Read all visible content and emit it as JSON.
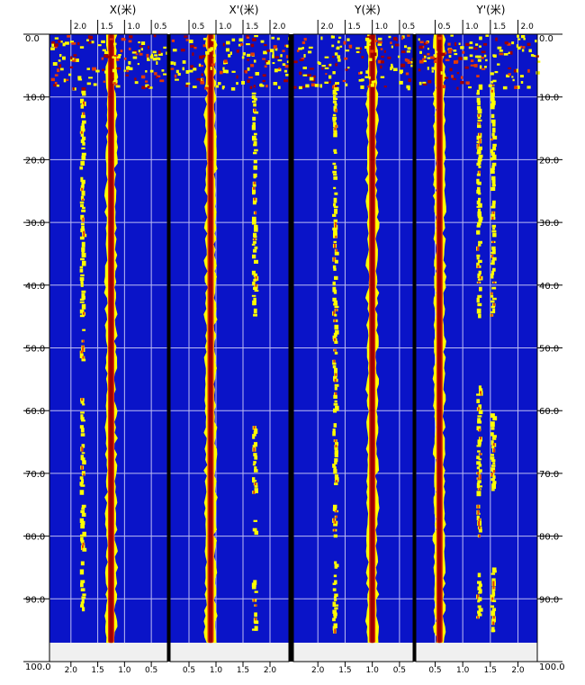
{
  "chart_data": {
    "type": "heatmap",
    "title": "",
    "depth_axis": {
      "range": [
        0,
        100
      ],
      "tick_labels": [
        "0.0",
        "10.0",
        "20.0",
        "30.0",
        "40.0",
        "50.0",
        "60.0",
        "70.0",
        "80.0",
        "90.0",
        "100.0"
      ]
    },
    "grid": true,
    "colors": {
      "background": "#0A14C8",
      "low": "#FFFF00",
      "mid": "#E53A00",
      "high": "#A00000",
      "no_data": "#F0F0F0",
      "gridline": "#BDBDF2",
      "separator": "#000000"
    },
    "panels": [
      {
        "title": "X(米)",
        "tick_labels": [
          "2.0",
          "1.5",
          "1.0",
          "0.5"
        ],
        "tick_values": [
          2.0,
          1.5,
          1.0,
          0.5
        ],
        "x_range": [
          2.4,
          0.2
        ],
        "reflections": [
          {
            "x": 1.78,
            "strength": "weak",
            "depth_ranges": [
              [
                9,
                45
              ],
              [
                47,
                52
              ],
              [
                58,
                73
              ],
              [
                75,
                82
              ],
              [
                84,
                86
              ],
              [
                87,
                92
              ]
            ]
          },
          {
            "x": 1.25,
            "strength": "strong",
            "depth_ranges": [
              [
                0,
                97
              ]
            ]
          }
        ]
      },
      {
        "title": "X'(米)",
        "tick_labels": [
          "0.5",
          "1.0",
          "1.5",
          "2.0"
        ],
        "tick_values": [
          0.5,
          1.0,
          1.5,
          2.0
        ],
        "x_range": [
          0.15,
          2.35
        ],
        "reflections": [
          {
            "x": 0.9,
            "strength": "strong",
            "depth_ranges": [
              [
                0,
                97
              ]
            ]
          },
          {
            "x": 1.72,
            "strength": "weak",
            "depth_ranges": [
              [
                8,
                45
              ],
              [
                62,
                73
              ],
              [
                77,
                80
              ],
              [
                87,
                95
              ]
            ]
          }
        ]
      },
      {
        "title": "Y(米)",
        "tick_labels": [
          "2.0",
          "1.5",
          "1.0",
          "0.5"
        ],
        "tick_values": [
          2.0,
          1.5,
          1.0,
          0.5
        ],
        "x_range": [
          2.45,
          0.25
        ],
        "reflections": [
          {
            "x": 1.68,
            "strength": "weak",
            "depth_ranges": [
              [
                8,
                60
              ],
              [
                62,
                72
              ],
              [
                75,
                80
              ],
              [
                84,
                95
              ]
            ]
          },
          {
            "x": 1.0,
            "strength": "strong",
            "depth_ranges": [
              [
                0,
                97
              ]
            ]
          }
        ]
      },
      {
        "title": "Y'(米)",
        "tick_labels": [
          "0.5",
          "1.0",
          "1.5",
          "2.0"
        ],
        "tick_values": [
          0.5,
          1.0,
          1.5,
          2.0
        ],
        "x_range": [
          0.15,
          2.35
        ],
        "reflections": [
          {
            "x": 0.58,
            "strength": "strong",
            "depth_ranges": [
              [
                0,
                97
              ]
            ]
          },
          {
            "x": 1.3,
            "strength": "weak",
            "depth_ranges": [
              [
                8,
                45
              ],
              [
                56,
                73
              ],
              [
                75,
                80
              ],
              [
                85,
                93
              ]
            ]
          },
          {
            "x": 1.55,
            "strength": "weak",
            "depth_ranges": [
              [
                8,
                45
              ],
              [
                60,
                73
              ],
              [
                85,
                95
              ]
            ]
          }
        ]
      }
    ]
  }
}
